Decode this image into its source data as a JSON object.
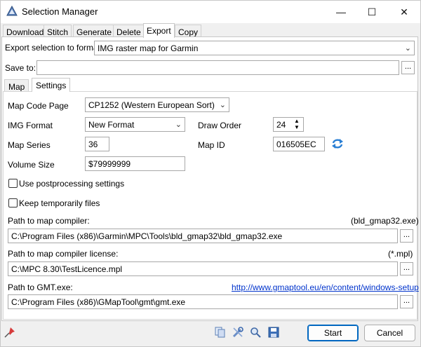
{
  "window": {
    "title": "Selection Manager",
    "controls": {
      "minimize": "—",
      "maximize": "☐",
      "close": "✕"
    }
  },
  "top_tabs": [
    "Download",
    "Stitch",
    "Generate",
    "Delete",
    "Export",
    "Copy"
  ],
  "active_top_tab": "Export",
  "export": {
    "format_label": "Export selection to format",
    "format_value": "IMG raster map for Garmin",
    "save_to_label": "Save to:",
    "save_to_value": "",
    "browse_label": "..."
  },
  "inner_tabs": [
    "Map",
    "Settings"
  ],
  "active_inner_tab": "Settings",
  "settings": {
    "code_page_label": "Map Code Page",
    "code_page_value": "CP1252 (Western European Sort)",
    "img_format_label": "IMG Format",
    "img_format_value": "New Format",
    "draw_order_label": "Draw Order",
    "draw_order_value": "24",
    "map_series_label": "Map Series",
    "map_series_value": "36",
    "map_id_label": "Map ID",
    "map_id_value": "016505EC",
    "volume_size_label": "Volume Size",
    "volume_size_value": "$79999999",
    "use_postprocessing_label": "Use postprocessing settings",
    "use_postprocessing_checked": false,
    "keep_temp_label": "Keep temporarily files",
    "keep_temp_checked": false,
    "compiler_path_label": "Path to map compiler:",
    "compiler_path_hint": "(bld_gmap32.exe)",
    "compiler_path_value": "C:\\Program Files (x86)\\Garmin\\MPC\\Tools\\bld_gmap32\\bld_gmap32.exe",
    "license_path_label": "Path to map compiler license:",
    "license_path_hint": "(*.mpl)",
    "license_path_value": "C:\\MPC 8.30\\TestLicence.mpl",
    "gmt_path_label": "Path to GMT.exe:",
    "gmt_link": "http://www.gmaptool.eu/en/content/windows-setup",
    "gmt_path_value": "C:\\Program Files (x86)\\GMapTool\\gmt\\gmt.exe",
    "browse_label": "..."
  },
  "footer": {
    "start_label": "Start",
    "cancel_label": "Cancel"
  },
  "icons": {
    "pin": "pin-icon",
    "copy": "copy-icon",
    "tools": "tools-icon",
    "search": "search-icon",
    "save": "save-icon",
    "refresh": "refresh-icon"
  },
  "colors": {
    "accent": "#0067c0",
    "link": "#0033cc"
  }
}
